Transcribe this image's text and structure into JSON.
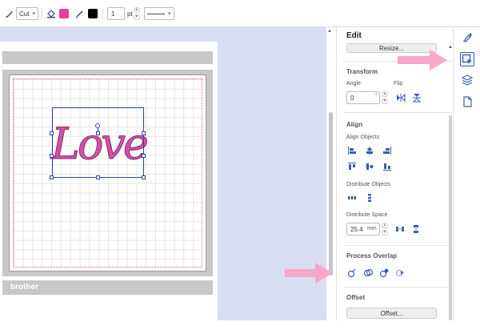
{
  "toolbar": {
    "mode_label": "Cut",
    "fill_color": "#e83e9a",
    "line_color": "#000000",
    "line_width": "1",
    "line_width_unit": "pt"
  },
  "mat": {
    "brand": "brother"
  },
  "panel": {
    "title": "Edit",
    "resize_button": "Resize...",
    "transform": {
      "title": "Transform",
      "angle_label": "Angle",
      "angle_value": "0",
      "angle_unit": "°",
      "flip_label": "Flip"
    },
    "align": {
      "title": "Align",
      "align_objects_label": "Align Objects",
      "distribute_objects_label": "Distribute Objects",
      "distribute_space_label": "Distribute Space",
      "space_value": "25.4",
      "space_unit": "mm"
    },
    "process_overlap": {
      "title": "Process Overlap"
    },
    "offset": {
      "title": "Offset",
      "button": "Offset..."
    }
  },
  "design": {
    "text": "Love",
    "color": "#d450a8"
  },
  "annotation_color": "#f7a8c8"
}
